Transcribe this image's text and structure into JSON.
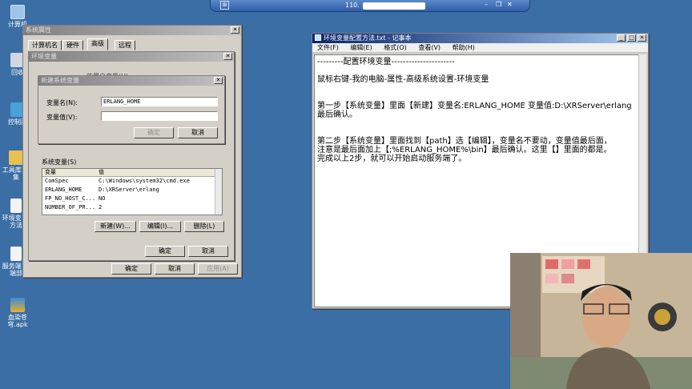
{
  "rdp_bar": {
    "title_prefix": "110."
  },
  "desktop": {
    "icons": [
      {
        "label": "计算机"
      },
      {
        "label": "回收"
      },
      {
        "label": "控制面"
      },
      {
        "label": "工具库 合集"
      },
      {
        "label": "环境变 置方法"
      },
      {
        "label": "服务端 户端部"
      },
      {
        "label": "血染苍穹.apk"
      }
    ]
  },
  "sys_props": {
    "title": "系统属性",
    "tabs": [
      "计算机名",
      "硬件",
      "高级",
      "远程"
    ],
    "ok": "确定",
    "cancel": "取消",
    "apply": "应用(A)"
  },
  "env_dialog": {
    "title": "环境变量",
    "user_vars_partial": "的用户变量(U)",
    "sys_vars_label": "系统变量(S)",
    "columns": [
      "变量",
      "值"
    ],
    "rows": [
      {
        "name": "ComSpec",
        "value": "C:\\Windows\\system32\\cmd.exe"
      },
      {
        "name": "ERLANG_HOME",
        "value": "D:\\XRServer\\erlang"
      },
      {
        "name": "FP_NO_HOST_C...",
        "value": "NO"
      },
      {
        "name": "NUMBER_OF_PR...",
        "value": "2"
      }
    ],
    "new_btn": "新建(W)...",
    "edit_btn": "编辑(I)...",
    "delete_btn": "删除(L)",
    "ok": "确定",
    "cancel": "取消"
  },
  "new_var_dialog": {
    "title": "新建系统变量",
    "name_label": "变量名(N):",
    "name_value": "ERLANG_HOME",
    "value_label": "变量值(V):",
    "value_value": "",
    "ok": "确定",
    "cancel": "取消"
  },
  "notepad": {
    "title": "环境变量配置方法.txt - 记事本",
    "menus": [
      "文件(F)",
      "编辑(E)",
      "格式(O)",
      "查看(V)",
      "帮助(H)"
    ],
    "lines": [
      "---------配置环境变量----------------------",
      "",
      "鼠标右键-我的电脑-属性-高级系统设置-环境变量",
      "",
      "",
      "第一步【系统变量】里面【新建】变量名:ERLANG_HOME 变量值:D:\\XRServer\\erlang",
      "最后确认。",
      "",
      "",
      "第二步【系统变量】里面找到【path】选【编辑】，变量名不要动，变量值最后面，",
      "注意是最后面加上【;%ERLANG_HOME%\\bin】最后确认。这里【】里面的都是。",
      "完成以上2步，就可以开始启动服务端了。"
    ]
  },
  "colors": {
    "desktop": "#3a6ea5",
    "title_active": "#0a246a",
    "window_face": "#d4d0c8"
  }
}
